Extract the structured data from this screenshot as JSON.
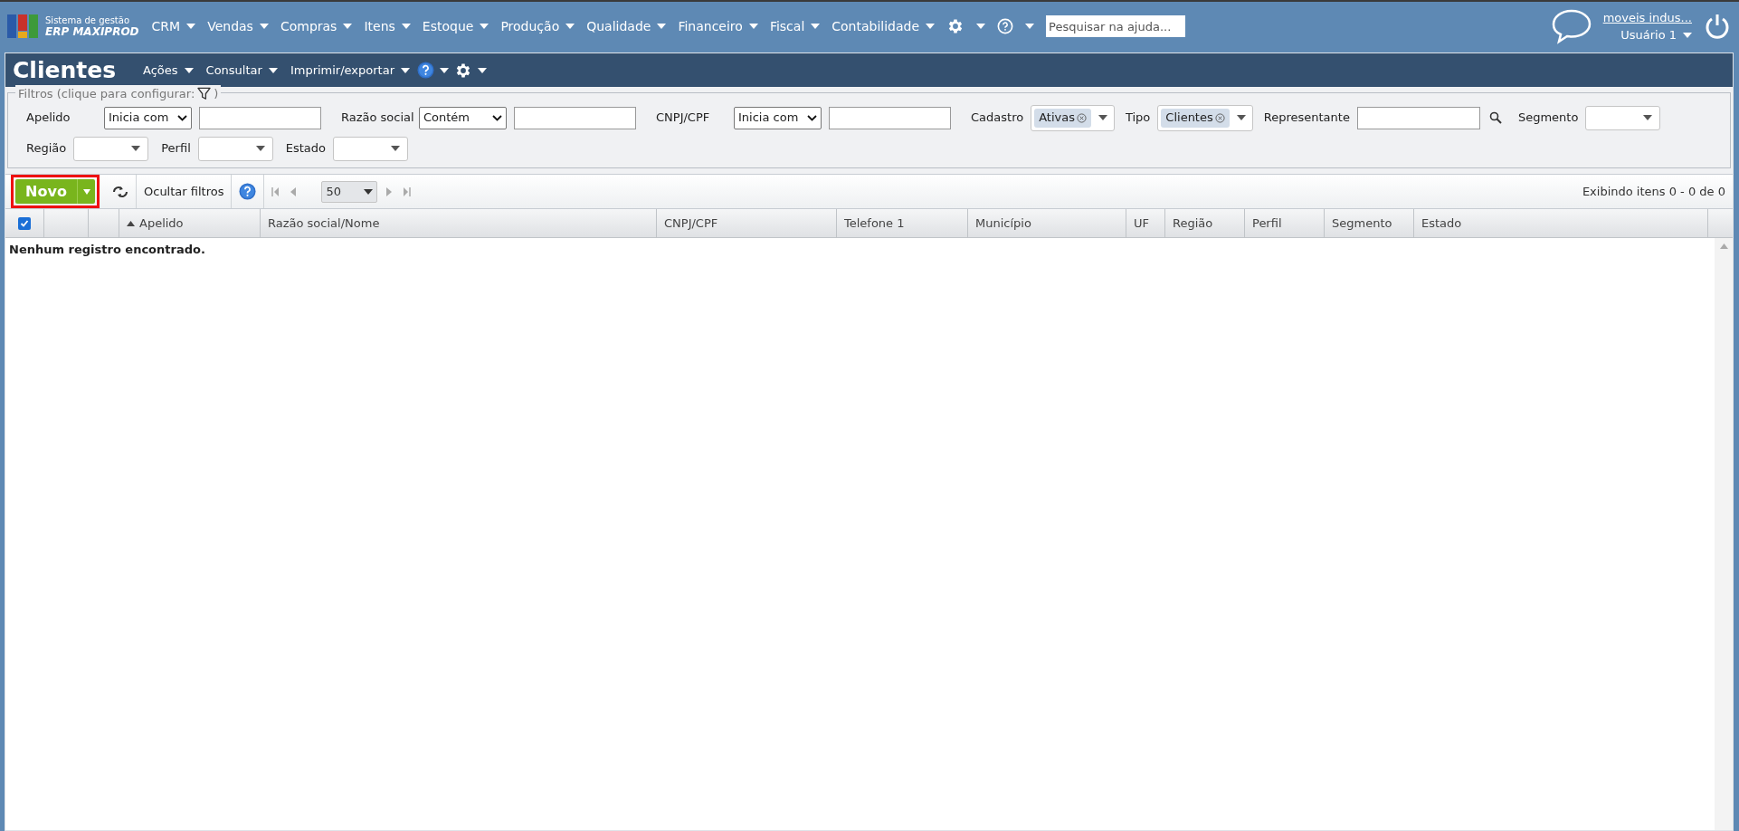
{
  "brand": {
    "line1": "Sistema de gestão",
    "line2": "ERP MAXIPROD"
  },
  "menu": [
    {
      "label": "CRM"
    },
    {
      "label": "Vendas"
    },
    {
      "label": "Compras"
    },
    {
      "label": "Itens"
    },
    {
      "label": "Estoque"
    },
    {
      "label": "Produção"
    },
    {
      "label": "Qualidade"
    },
    {
      "label": "Financeiro"
    },
    {
      "label": "Fiscal"
    },
    {
      "label": "Contabilidade"
    }
  ],
  "help_search": {
    "placeholder": "Pesquisar na ajuda..."
  },
  "user": {
    "company": "moveis indus...",
    "name": "Usuário 1"
  },
  "page": {
    "title": "Clientes",
    "actions": [
      {
        "label": "Ações"
      },
      {
        "label": "Consultar"
      },
      {
        "label": "Imprimir/exportar"
      }
    ]
  },
  "filters": {
    "legend_start": "Filtros (clique para configurar:",
    "legend_end": ")",
    "rows": [
      [
        {
          "kind": "operator",
          "label": "Apelido",
          "operator": "Inicia com"
        },
        {
          "kind": "operator",
          "label": "Razão social",
          "operator": "Contém"
        },
        {
          "kind": "operator",
          "label": "CNPJ/CPF",
          "operator": "Inicia com"
        },
        {
          "kind": "tags",
          "label": "Cadastro",
          "tags": [
            "Ativas"
          ]
        },
        {
          "kind": "tags",
          "label": "Tipo",
          "tags": [
            "Clientes"
          ]
        },
        {
          "kind": "lookup",
          "label": "Representante"
        },
        {
          "kind": "select",
          "label": "Segmento"
        }
      ],
      [
        {
          "kind": "select",
          "label": "Região"
        },
        {
          "kind": "select",
          "label": "Perfil"
        },
        {
          "kind": "select",
          "label": "Estado"
        }
      ]
    ]
  },
  "toolbar": {
    "new_button": {
      "label": "Novo",
      "highlighted": true
    },
    "hide_filters": "Ocultar filtros",
    "page_size": "50",
    "status": "Exibindo itens 0 - 0 de 0"
  },
  "table": {
    "select_all": {
      "checked": true
    },
    "columns": [
      {
        "label": "Apelido",
        "sorted": true
      },
      {
        "label": "Razão social/Nome",
        "sorted": false
      },
      {
        "label": "CNPJ/CPF",
        "sorted": false
      },
      {
        "label": "Telefone 1",
        "sorted": false
      },
      {
        "label": "Município",
        "sorted": false
      },
      {
        "label": "UF",
        "sorted": false
      },
      {
        "label": "Região",
        "sorted": false
      },
      {
        "label": "Perfil",
        "sorted": false
      },
      {
        "label": "Segmento",
        "sorted": false
      },
      {
        "label": "Estado",
        "sorted": false
      }
    ],
    "empty_message": "Nenhum registro encontrado."
  }
}
